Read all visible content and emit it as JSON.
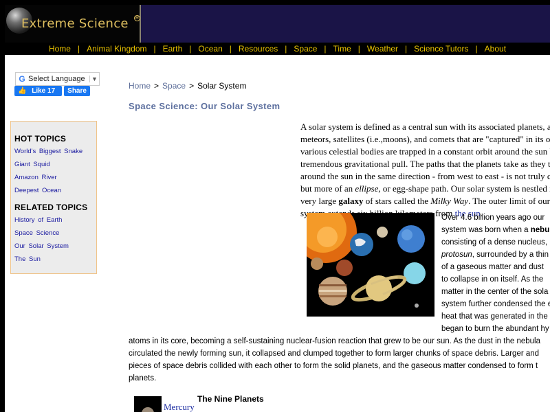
{
  "site": {
    "logo_text": "Extreme Science",
    "logo_reg": "R"
  },
  "nav": [
    "Home",
    "Animal Kingdom",
    "Earth",
    "Ocean",
    "Resources",
    "Space",
    "Time",
    "Weather",
    "Science Tutors",
    "About"
  ],
  "translate": {
    "label": "Select Language",
    "icon": "google-g-icon"
  },
  "facebook": {
    "like": "Like 17",
    "share": "Share"
  },
  "sidebar": {
    "hot_title": "HOT TOPICS",
    "hot": [
      "World's Biggest Snake",
      "Giant Squid",
      "Amazon River",
      "Deepest Ocean"
    ],
    "related_title": "RELATED TOPICS",
    "related": [
      "History of Earth",
      "Space Science",
      "Our Solar System",
      "The Sun"
    ]
  },
  "breadcrumb": {
    "home": "Home",
    "sep": ">",
    "space": "Space",
    "current": "Solar System"
  },
  "title": "Space Science: Our Solar System",
  "intro": {
    "l1": "A solar system is defined as a central sun with its associated planets, aste",
    "l2": "meteors, satellites (i.e.,moons), and comets that are \"captured\" in its orbi",
    "l3": "various celestial bodies are trapped in a constant orbit around the sun by",
    "l4": "tremendous gravitational pull. The paths that the planets take as they trav",
    "l5": "around the sun in the same direction - from west to east - is not truly circ",
    "l6a": "but more of an ",
    "l6b": "ellipse",
    "l6c": ", or egg-shape path. Our solar system is nestled ins",
    "l7a": "very large ",
    "l7b": "galaxy",
    "l7c": " of stars called the ",
    "l7d": "Milky Way",
    "l7e": ". The outer limit of our so",
    "l8a": "system extends six billion kilometers from ",
    "l8b": "the sun",
    "l8c": "."
  },
  "side": {
    "l1": "Over 4.6 billion years ago our",
    "l2a": "system was born when a ",
    "l2b": "nebu",
    "l3": "consisting of a dense nucleus,",
    "l4a": "protosun",
    "l4b": ", surrounded by a thin",
    "l5": "of a gaseous matter and dust",
    "l6": "to collapse in on itself. As the",
    "l7": "matter in the center of the sola",
    "l8": "system further condensed the e",
    "l9": "heat that was generated in the",
    "l10": "began to burn the abundant hy"
  },
  "full": {
    "l1": "atoms in its core, becoming a self-sustaining nuclear-fusion reaction that grew to be our sun. As the dust in the nebula",
    "l2": "circulated the newly forming sun, it collapsed and clumped together to form larger chunks of space debris. Larger and",
    "l3": "pieces of space debris collided with each other to form the solid planets, and the gaseous matter condensed to form t",
    "l4": "planets."
  },
  "nine": {
    "title": "The Nine Planets",
    "mercury": "Mercury"
  },
  "colors": {
    "nav_text": "#e8c200",
    "header_bg": "#1a1747",
    "link": "#1a2aa0",
    "title": "#5c6f9e"
  }
}
